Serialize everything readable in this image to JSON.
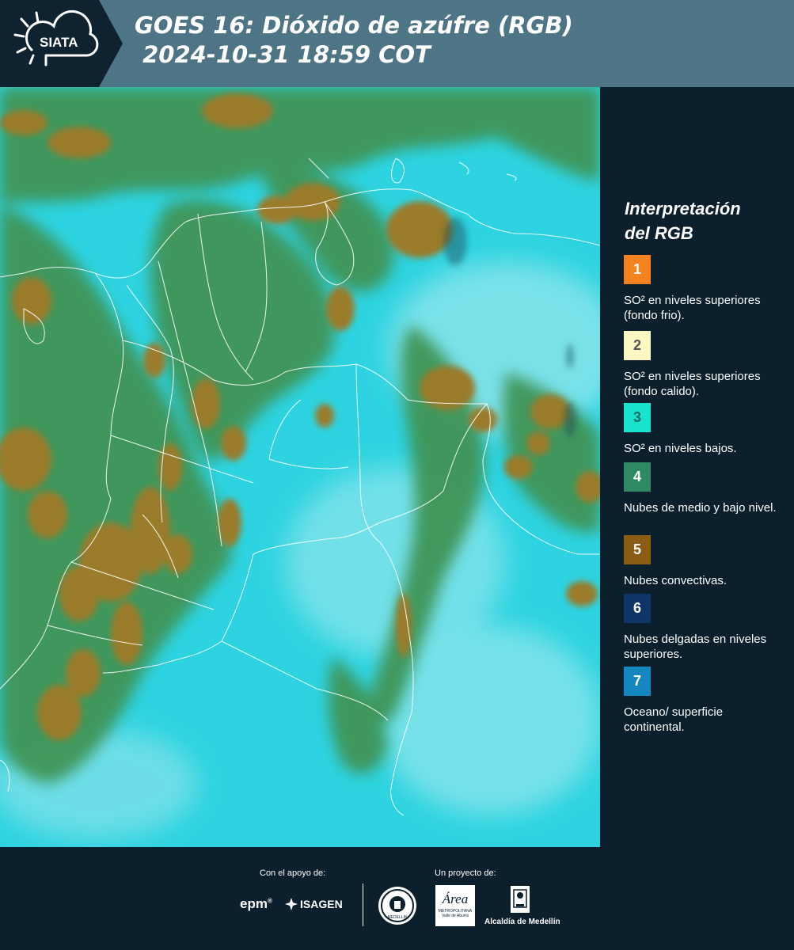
{
  "header": {
    "logo_text": "SIATA",
    "title_line1": "GOES 16: Dióxido de azúfre (RGB)",
    "title_line2": " 2024-10-31 18:59 COT"
  },
  "legend": {
    "title_line1": "Interpretación",
    "title_line2": "del RGB",
    "items": [
      {
        "num": "1",
        "color": "#f5821f",
        "num_color": "#ffffff",
        "text": "SO² en niveles superiores (fondo frio)."
      },
      {
        "num": "2",
        "color": "#fdf7c3",
        "num_color": "#555555",
        "text": "SO² en niveles superiores (fondo calido)."
      },
      {
        "num": "3",
        "color": "#19e3cc",
        "num_color": "#1b6b6a",
        "text": "SO² en niveles bajos."
      },
      {
        "num": "4",
        "color": "#2f8a63",
        "num_color": "#ffffff",
        "text": "Nubes de medio y bajo nivel."
      },
      {
        "num": "5",
        "color": "#8a5c14",
        "num_color": "#ffffff",
        "text": "Nubes convectivas."
      },
      {
        "num": "6",
        "color": "#0e3566",
        "num_color": "#ffffff",
        "text": "Nubes delgadas en niveles superiores."
      },
      {
        "num": "7",
        "color": "#1587c0",
        "num_color": "#ffffff",
        "text": "Oceano/ superficie continental."
      }
    ]
  },
  "footer": {
    "support_label": "Con el apoyo de:",
    "project_label": "Un proyecto de:",
    "epm_text": "epm",
    "isagen_text": "ISAGEN",
    "area_text": "Área",
    "area_sub": "METROPOLITANA",
    "area_sub2": "Valle de Aburrá",
    "alcaldia_text": "Alcaldía de Medellín",
    "seal_text": "MEDELLIN"
  },
  "colors": {
    "header_bg": "#4e7585",
    "logo_bg": "#0f2230",
    "page_bg": "#0b1f2c",
    "map_cyan": "#28d3e2",
    "map_green": "#3a8a4a",
    "map_brown": "#9a7a2a"
  }
}
